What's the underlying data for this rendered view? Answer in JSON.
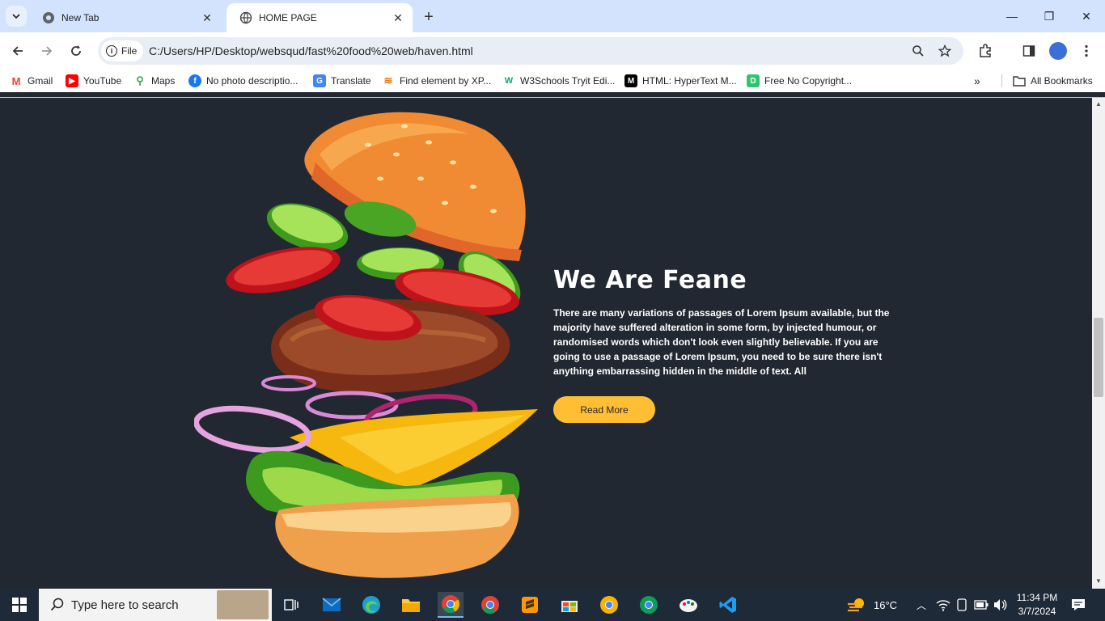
{
  "browser": {
    "tabs": [
      {
        "title": "New Tab",
        "active": false
      },
      {
        "title": "HOME PAGE",
        "active": true
      }
    ],
    "new_tab_symbol": "+",
    "site_info_label": "File",
    "url": "C:/Users/HP/Desktop/websqud/fast%20food%20web/haven.html",
    "bookmarks": [
      {
        "label": "Gmail",
        "icon": "gmail-icon",
        "color": "#ea4335"
      },
      {
        "label": "YouTube",
        "icon": "youtube-icon",
        "color": "#ff0000"
      },
      {
        "label": "Maps",
        "icon": "maps-icon",
        "color": "#34a853"
      },
      {
        "label": "No photo descriptio...",
        "icon": "facebook-icon",
        "color": "#1877f2"
      },
      {
        "label": "Translate",
        "icon": "translate-icon",
        "color": "#4285f4"
      },
      {
        "label": "Find element by XP...",
        "icon": "xpath-icon",
        "color": "#e8710a"
      },
      {
        "label": "W3Schools Tryit Edi...",
        "icon": "w3schools-icon",
        "color": "#04aa6d"
      },
      {
        "label": "HTML: HyperText M...",
        "icon": "mdn-icon",
        "color": "#000000"
      },
      {
        "label": "Free No Copyright...",
        "icon": "pixabay-icon",
        "color": "#2ec66d"
      }
    ],
    "all_bookmarks_label": "All Bookmarks"
  },
  "page": {
    "heading": "We Are Feane",
    "body": "There are many variations of passages of Lorem Ipsum available, but the majority have suffered alteration in some form, by injected humour, or randomised words which don't look even slightly believable. If you are going to use a passage of Lorem Ipsum, you need to be sure there isn't anything embarrassing hidden in the middle of text. All",
    "button_label": "Read More",
    "colors": {
      "background": "#222831",
      "accent": "#ffbe33"
    }
  },
  "taskbar": {
    "search_placeholder": "Type here to search",
    "weather": "16°C",
    "time": "11:34 PM",
    "date": "3/7/2024"
  }
}
